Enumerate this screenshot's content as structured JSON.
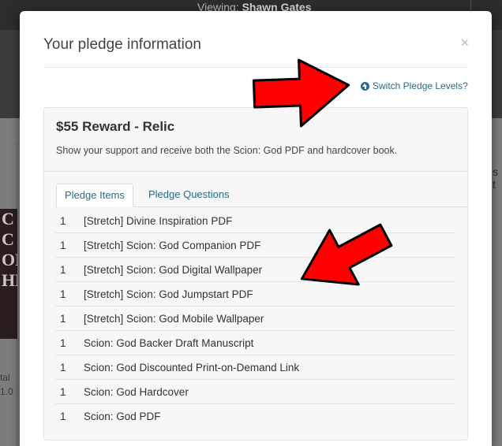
{
  "background": {
    "viewing_label": "Viewing:",
    "viewing_user": "Shawn Gates",
    "cover_text": [
      "C",
      "C",
      "OR",
      "HE"
    ],
    "left_text": [
      "tal",
      "1.0"
    ],
    "right_text": "s t"
  },
  "modal": {
    "title": "Your pledge information",
    "close": "×",
    "switch_link": "Switch Pledge Levels?",
    "reward_title": "$55 Reward - Relic",
    "reward_desc": "Show your support and receive both the Scion: God PDF and hardcover book.",
    "tabs": [
      "Pledge Items",
      "Pledge Questions"
    ],
    "items": [
      {
        "qty": "1",
        "name": "[Stretch] Divine Inspiration PDF"
      },
      {
        "qty": "1",
        "name": "[Stretch] Scion: God Companion PDF"
      },
      {
        "qty": "1",
        "name": "[Stretch] Scion: God Digital Wallpaper"
      },
      {
        "qty": "1",
        "name": "[Stretch] Scion: God Jumpstart PDF"
      },
      {
        "qty": "1",
        "name": "[Stretch] Scion: God Mobile Wallpaper"
      },
      {
        "qty": "1",
        "name": "Scion: God Backer Draft Manuscript"
      },
      {
        "qty": "1",
        "name": "Scion: God Discounted Print-on-Demand Link"
      },
      {
        "qty": "1",
        "name": "Scion: God Hardcover"
      },
      {
        "qty": "1",
        "name": "Scion: God PDF"
      }
    ]
  },
  "colors": {
    "link": "#2b6a8a",
    "arrow": "#ff0000"
  },
  "icons": [
    "arrow-circle-up-icon",
    "close-icon",
    "red-arrow-annotation"
  ]
}
